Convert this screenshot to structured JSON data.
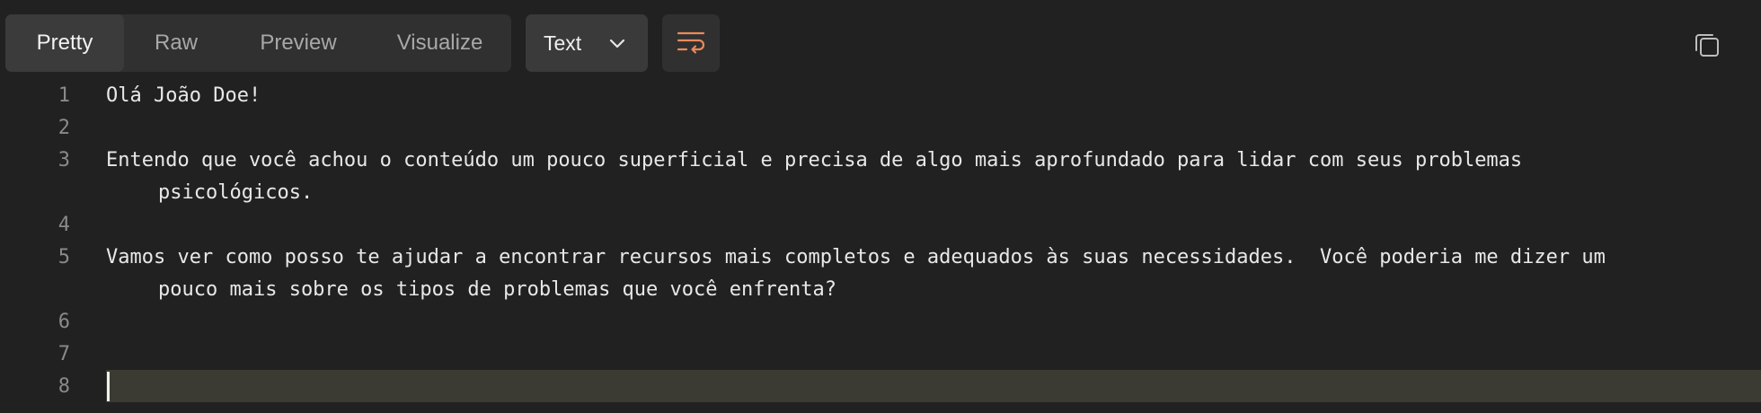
{
  "tabs": [
    {
      "label": "Pretty",
      "active": true
    },
    {
      "label": "Raw",
      "active": false
    },
    {
      "label": "Preview",
      "active": false
    },
    {
      "label": "Visualize",
      "active": false
    }
  ],
  "format_dropdown": {
    "selected": "Text"
  },
  "icons": {
    "dropdown": "chevron-down-icon",
    "wrap": "word-wrap-icon",
    "copy": "copy-icon"
  },
  "colors": {
    "accent": "#ea8a5a",
    "background": "#212121",
    "active_line": "#3c3b33"
  },
  "editor": {
    "lines": [
      {
        "number": "1",
        "text": "Olá João Doe!",
        "cont": ""
      },
      {
        "number": "2",
        "text": "",
        "cont": ""
      },
      {
        "number": "3",
        "text": "Entendo que você achou o conteúdo um pouco superficial e precisa de algo mais aprofundado para lidar com seus problemas",
        "cont": "psicológicos."
      },
      {
        "number": "4",
        "text": "",
        "cont": ""
      },
      {
        "number": "5",
        "text": "Vamos ver como posso te ajudar a encontrar recursos mais completos e adequados às suas necessidades.  Você poderia me dizer um",
        "cont": "pouco mais sobre os tipos de problemas que você enfrenta?"
      },
      {
        "number": "6",
        "text": "",
        "cont": ""
      },
      {
        "number": "7",
        "text": "",
        "cont": ""
      },
      {
        "number": "8",
        "text": "",
        "cont": ""
      }
    ]
  }
}
